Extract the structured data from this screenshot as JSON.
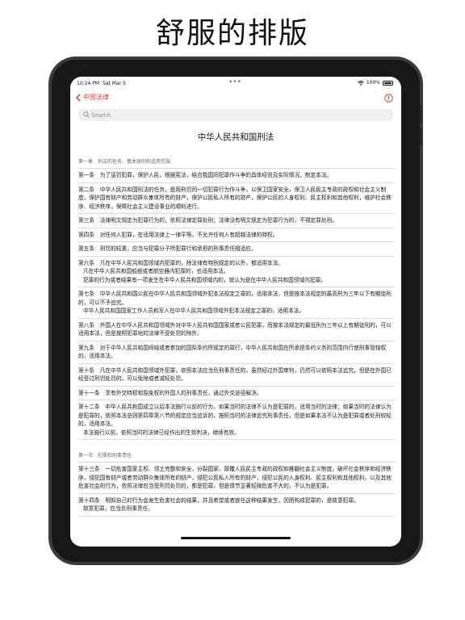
{
  "headline": "舒服的排版",
  "status": {
    "time": "10:24 PM",
    "date": "Sat Mar 5",
    "dots": "•••",
    "battery": "100%"
  },
  "nav": {
    "back_label": "中国法律"
  },
  "search": {
    "placeholder": "Search"
  },
  "document": {
    "title": "中华人民共和国刑法",
    "chapter1_heading": "第一章　刑法的任务、基本原则和适用范围",
    "articles1": [
      [
        "第一条　为了惩罚犯罪，保护人民，根据宪法，结合我国同犯罪作斗争的具体经验及实际情况，制定本法。"
      ],
      [
        "第二条　中华人民共和国刑法的任务，是用刑罚同一切犯罪行为作斗争，以保卫国家安全，保卫人民民主专政的政权和社会主义制度，保护国有财产和劳动群众集体所有的财产，保护公民私人所有的财产，保护公民的人身权利、民主权利和其他权利，维护社会秩序、经济秩序，保障社会主义建设事业的顺利进行。"
      ],
      [
        "第三条　法律明文规定为犯罪行为的，依照法律定罪处刑；法律没有明文规定为犯罪行为的，不得定罪处刑。"
      ],
      [
        "第四条　对任何人犯罪，在适用法律上一律平等。不允许任何人有超越法律的特权。"
      ],
      [
        "第五条　刑罚的轻重，应当与犯罪分子所犯罪行和承担的刑事责任相适应。"
      ],
      [
        "第六条　凡在中华人民共和国领域内犯罪的，除法律有特别规定的以外，都适用本法。",
        "凡在中华人民共和国船舶或者航空器内犯罪的，也适用本法。",
        "犯罪的行为或者结果有一项发生在中华人民共和国领域内的，就认为是在中华人民共和国领域内犯罪。"
      ],
      [
        "第七条　中华人民共和国公民在中华人民共和国领域外犯本法规定之罪的，适用本法，但是按本法规定的最高刑为三年以下有期徒刑的，可以不予追究。",
        "中华人民共和国国家工作人员和军人在中华人民共和国领域外犯本法规定之罪的，适用本法。"
      ],
      [
        "第八条　外国人在中华人民共和国领域外对中华人民共和国国家或者公民犯罪，而按本法规定的最低刑为三年以上有期徒刑的，可以适用本法，但是按照犯罪地的法律不受处罚的除外。"
      ],
      [
        "第九条　对于中华人民共和国缔结或者参加的国际条约所规定的罪行，中华人民共和国在所承担条约义务的范围内行使刑事管辖权的，适用本法。"
      ],
      [
        "第十条　凡在中华人民共和国领域外犯罪，依照本法应当负刑事责任的，虽然经过外国审判，仍然可以依照本法追究，但是在外国已经受过刑罚处罚的，可以免除或者减轻处罚。"
      ],
      [
        "第十一条　享有外交特权和豁免权的外国人的刑事责任，通过外交途径解决。"
      ],
      [
        "第十二条　中华人民共和国成立以后本法施行以前的行为，如果当时的法律不认为是犯罪的，适用当时的法律；如果当时的法律认为是犯罪的，依照本法总则第四章第八节的规定应当追诉的，按照当时的法律追究刑事责任，但是如果本法不认为是犯罪或者处刑较轻的，适用本法。",
        "本法施行以前，依照当时的法律已经作出的生效判决，继续有效。"
      ]
    ],
    "section1_heading": "第一节　犯罪和刑事责任",
    "articles2": [
      [
        "第十三条　一切危害国家主权、领土完整和安全，分裂国家、颠覆人民民主专政的政权和推翻社会主义制度，破坏社会秩序和经济秩序，侵犯国有财产或者劳动群众集体所有的财产，侵犯公民私人所有的财产，侵犯公民的人身权利、民主权利和其他权利，以及其他危害社会的行为，依照法律应当受刑罚处罚的，都是犯罪，但是情节显著轻微危害不大的，不认为是犯罪。"
      ],
      [
        "第十四条　明知自己的行为会发生危害社会的结果，并且希望或者放任这种结果发生，因而构成犯罪的，是故意犯罪。",
        "故意犯罪，应当负刑事责任。"
      ]
    ]
  }
}
